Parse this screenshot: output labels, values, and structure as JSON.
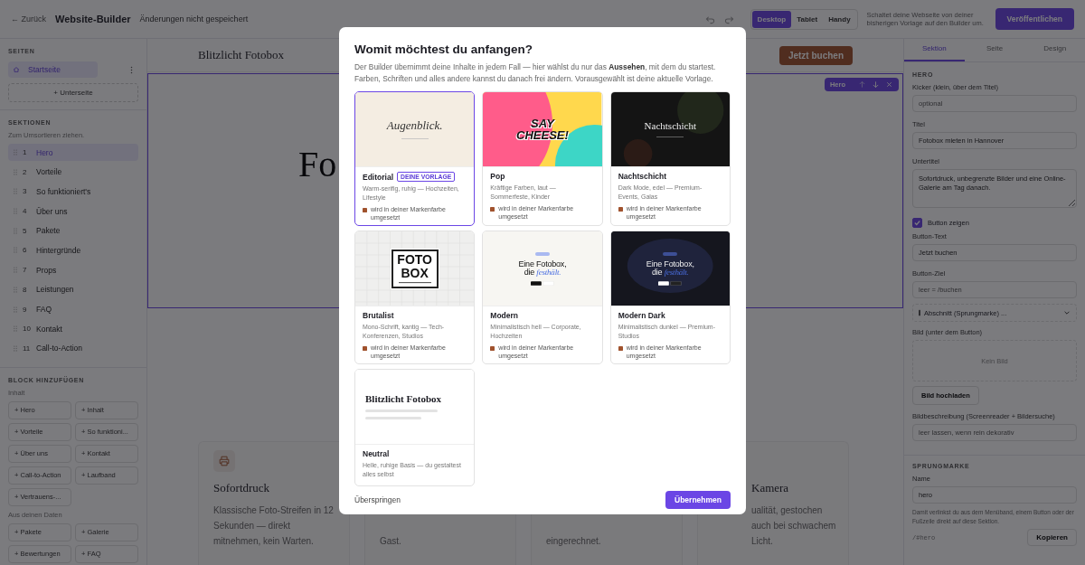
{
  "topbar": {
    "back": "← Zurück",
    "title": "Website-Builder",
    "status": "Änderungen nicht gespeichert",
    "devices": [
      {
        "label": "Desktop",
        "selected": true
      },
      {
        "label": "Tablet",
        "selected": false
      },
      {
        "label": "Handy",
        "selected": false
      }
    ],
    "hint": "Schaltet deine Webseite von deiner bisherigen Vorlage auf den Builder um.",
    "publish": "Veröffentlichen"
  },
  "sidebar": {
    "pages_heading": "SEITEN",
    "pages": [
      {
        "label": "Startseite",
        "selected": true
      }
    ],
    "add_page": "+ Unterseite",
    "sections_heading": "SEKTIONEN",
    "sections_hint": "Zum Umsortieren ziehen.",
    "sections": [
      {
        "number": "1",
        "label": "Hero",
        "selected": true
      },
      {
        "number": "2",
        "label": "Vorteile",
        "selected": false
      },
      {
        "number": "3",
        "label": "So funktioniert's",
        "selected": false
      },
      {
        "number": "4",
        "label": "Über uns",
        "selected": false
      },
      {
        "number": "5",
        "label": "Pakete",
        "selected": false
      },
      {
        "number": "6",
        "label": "Hintergründe",
        "selected": false
      },
      {
        "number": "7",
        "label": "Props",
        "selected": false
      },
      {
        "number": "8",
        "label": "Leistungen",
        "selected": false
      },
      {
        "number": "9",
        "label": "FAQ",
        "selected": false
      },
      {
        "number": "10",
        "label": "Kontakt",
        "selected": false
      },
      {
        "number": "11",
        "label": "Call-to-Action",
        "selected": false
      }
    ],
    "blocks_heading": "BLOCK HINZUFÜGEN",
    "block_groups": [
      {
        "label": "Inhalt",
        "blocks": [
          "+ Hero",
          "+ Inhalt",
          "+ Vorteile",
          "+ So funktioni...",
          "+ Über uns",
          "+ Kontakt",
          "+ Call-to-Action",
          "+ Laufband",
          "+ Vertrauens-..."
        ]
      },
      {
        "label": "Aus deinen Daten",
        "blocks": [
          "+ Pakete",
          "+ Galerie",
          "+ Bewertungen",
          "+ FAQ"
        ]
      }
    ]
  },
  "canvas": {
    "brand": "Blitzlicht Fotobox",
    "cta": "Jetzt buchen",
    "hero_title": "Fo",
    "hero_toolbar": {
      "label": "Hero"
    },
    "features": [
      {
        "kind": "icon_card",
        "title": "Sofortdruck",
        "text": "Klassische Foto-Streifen in 12 Sekunden — direkt mitnehmen, kein Warten."
      },
      {
        "text": "Gast."
      },
      {
        "text": "eingerechnet."
      },
      {
        "title": "Kamera",
        "text": "ualität, gestochen auch bei schwachem Licht."
      }
    ]
  },
  "panel": {
    "tabs": [
      {
        "label": "Sektion",
        "selected": true
      },
      {
        "label": "Seite",
        "selected": false
      },
      {
        "label": "Design",
        "selected": false
      }
    ],
    "section_heading": "HERO",
    "fields": [
      {
        "kind": "input",
        "label": "Kicker (klein, über dem Titel)",
        "placeholder": "optional"
      },
      {
        "kind": "input",
        "label": "Titel",
        "value": "Fotobox mieten in Hannover"
      },
      {
        "kind": "textarea",
        "label": "Untertitel",
        "value": "Sofortdruck, unbegrenzte Bilder und eine Online-Galerie am Tag danach."
      },
      {
        "kind": "checkbox",
        "label": "Button zeigen",
        "checked": true
      },
      {
        "kind": "input",
        "label": "Button-Text",
        "value": "Jetzt buchen"
      },
      {
        "kind": "input",
        "label": "Button-Ziel",
        "placeholder": "leer = /buchen"
      },
      {
        "kind": "select",
        "value": "Abschnitt (Sprungmarke) ..."
      },
      {
        "kind": "image",
        "label": "Bild (unter dem Button)",
        "empty_text": "Kein Bild",
        "button": "Bild hochladen"
      },
      {
        "kind": "input",
        "label": "Bildbeschreibung (Screenreader + Bildersuche)",
        "placeholder": "leer lassen, wenn rein dekorativ"
      }
    ],
    "anchor": {
      "heading": "SPRUNGMARKE",
      "label": "Name",
      "value": "hero",
      "help": "Damit verlinkst du aus dem Menüband, einem Button oder der Fußzeile direkt auf diese Sektion.",
      "path": "/#hero",
      "copy": "Kopieren"
    }
  },
  "modal": {
    "title": "Womit möchtest du anfangen?",
    "text": "Der Builder übernimmt deine Inhalte in jedem Fall — hier wählst du nur das **Aussehen**, mit dem du startest. Farben, Schriften und alles andere kannst du danach frei ändern. Vorausgewählt ist deine aktuelle Vorlage.",
    "templates": [
      {
        "name": "Editorial",
        "badge": "DEINE VORLAGE",
        "description": "Warm-serifig, ruhig — Hochzeiten, Lifestyle",
        "note": "wird in deiner Markenfarbe umgesetzt",
        "selected": true,
        "preview": {
          "kind": "editorial",
          "title": "Augenblick."
        }
      },
      {
        "name": "Pop",
        "description": "Kräftige Farben, laut — Sommerfeste, Kinder",
        "note": "wird in deiner Markenfarbe umgesetzt",
        "selected": false,
        "preview": {
          "kind": "pop",
          "title": "SAY CHEESE!"
        }
      },
      {
        "name": "Nachtschicht",
        "description": "Dark Mode, edel — Premium-Events, Galas",
        "note": "wird in deiner Markenfarbe umgesetzt",
        "selected": false,
        "preview": {
          "kind": "night",
          "title": "Nachtschicht"
        }
      },
      {
        "name": "Brutalist",
        "description": "Mono-Schrift, kantig — Tech-Konferenzen, Studios",
        "note": "wird in deiner Markenfarbe umgesetzt",
        "selected": false,
        "preview": {
          "kind": "brutalist",
          "title": "FOTO BOX"
        }
      },
      {
        "name": "Modern",
        "description": "Minimalistisch hell — Corporate, Hochzeiten",
        "note": "wird in deiner Markenfarbe umgesetzt",
        "selected": false,
        "preview": {
          "kind": "modern",
          "title": "Eine Fotobox, die *festhält.*"
        }
      },
      {
        "name": "Modern Dark",
        "description": "Minimalistisch dunkel — Premium-Studios",
        "note": "wird in deiner Markenfarbe umgesetzt",
        "selected": false,
        "preview": {
          "kind": "modern_dark",
          "title": "Eine Fotobox, die *festhält.*"
        }
      },
      {
        "name": "Neutral",
        "description": "Helle, ruhige Basis — du gestaltest alles selbst",
        "selected": false,
        "preview": {
          "kind": "neutral",
          "title": "Blitzlicht Fotobox"
        }
      }
    ],
    "skip": "Überspringen",
    "apply": "Übernehmen"
  }
}
